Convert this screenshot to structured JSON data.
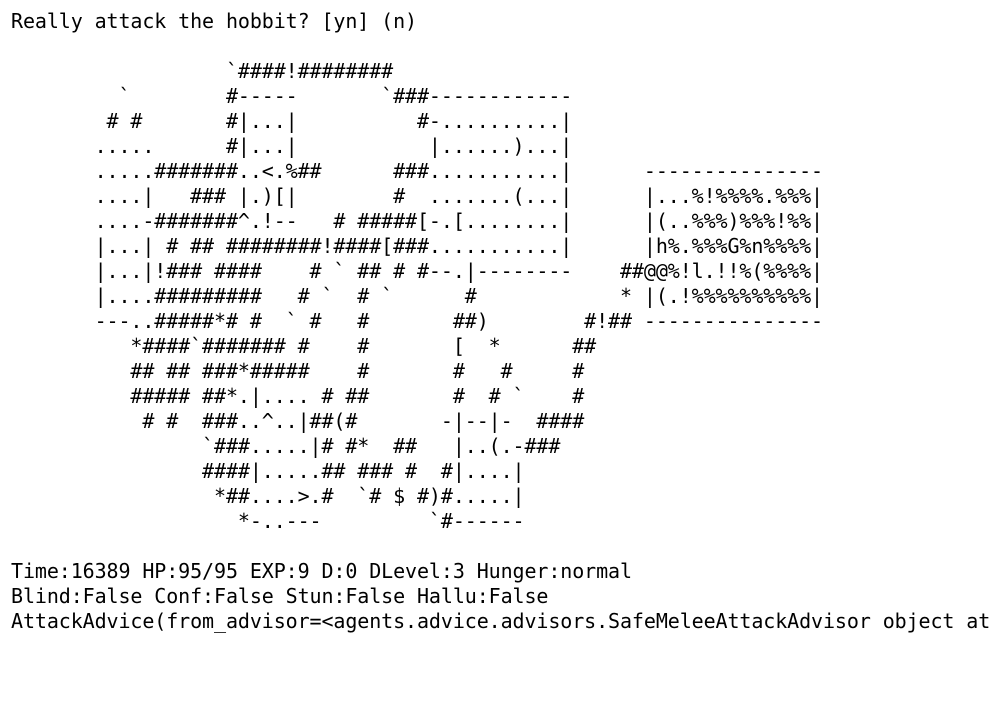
{
  "prompt": "Really attack the hobbit? [yn] (n)",
  "map": [
    "                  `####!########",
    "         `        #-----       `###------------",
    "        # #       #|...|          #-..........|",
    "       .....      #|...|           |......)...|",
    "       .....#######..<.%##      ###...........|      ---------------",
    "       ....|   ### |.)[|        #  .......(...|      |...%!%%%%.%%%|",
    "       ....-#######^.!--   # #####[-.[........|      |(..%%%)%%%!%%|",
    "       |...| # ## ########!####[###...........|      |h%.%%%G%n%%%%|",
    "       |...|!### ####    # ` ## # #--.|--------    ##@@%!l.!!%(%%%%|",
    "       |....#########   # `  # `      #            * |(.!%%%%%%%%%%|",
    "       ---..#####*# #  ` #   #       ##)        #!## ---------------",
    "          *####`####### #    #       [  *      ##",
    "          ## ## ###*#####    #       #   #     #",
    "          ##### ##*.|.... # ##       #  # `    #",
    "           # #  ###..^..|##(#       -|--|-  ####",
    "                `###.....|# #*  ##   |..(.-###",
    "                ####|.....## ### #  #|....|",
    "                 *##....>.#  `# $ #)#.....|",
    "                   *-..---         `#------"
  ],
  "status": {
    "line1": "Time:16389 HP:95/95 EXP:9 D:0 DLevel:3 Hunger:normal",
    "line2": "Blind:False Conf:False Stun:False Hallu:False",
    "line3": "AttackAdvice(from_advisor=<agents.advice.advisors.SafeMeleeAttackAdvisor object at"
  }
}
